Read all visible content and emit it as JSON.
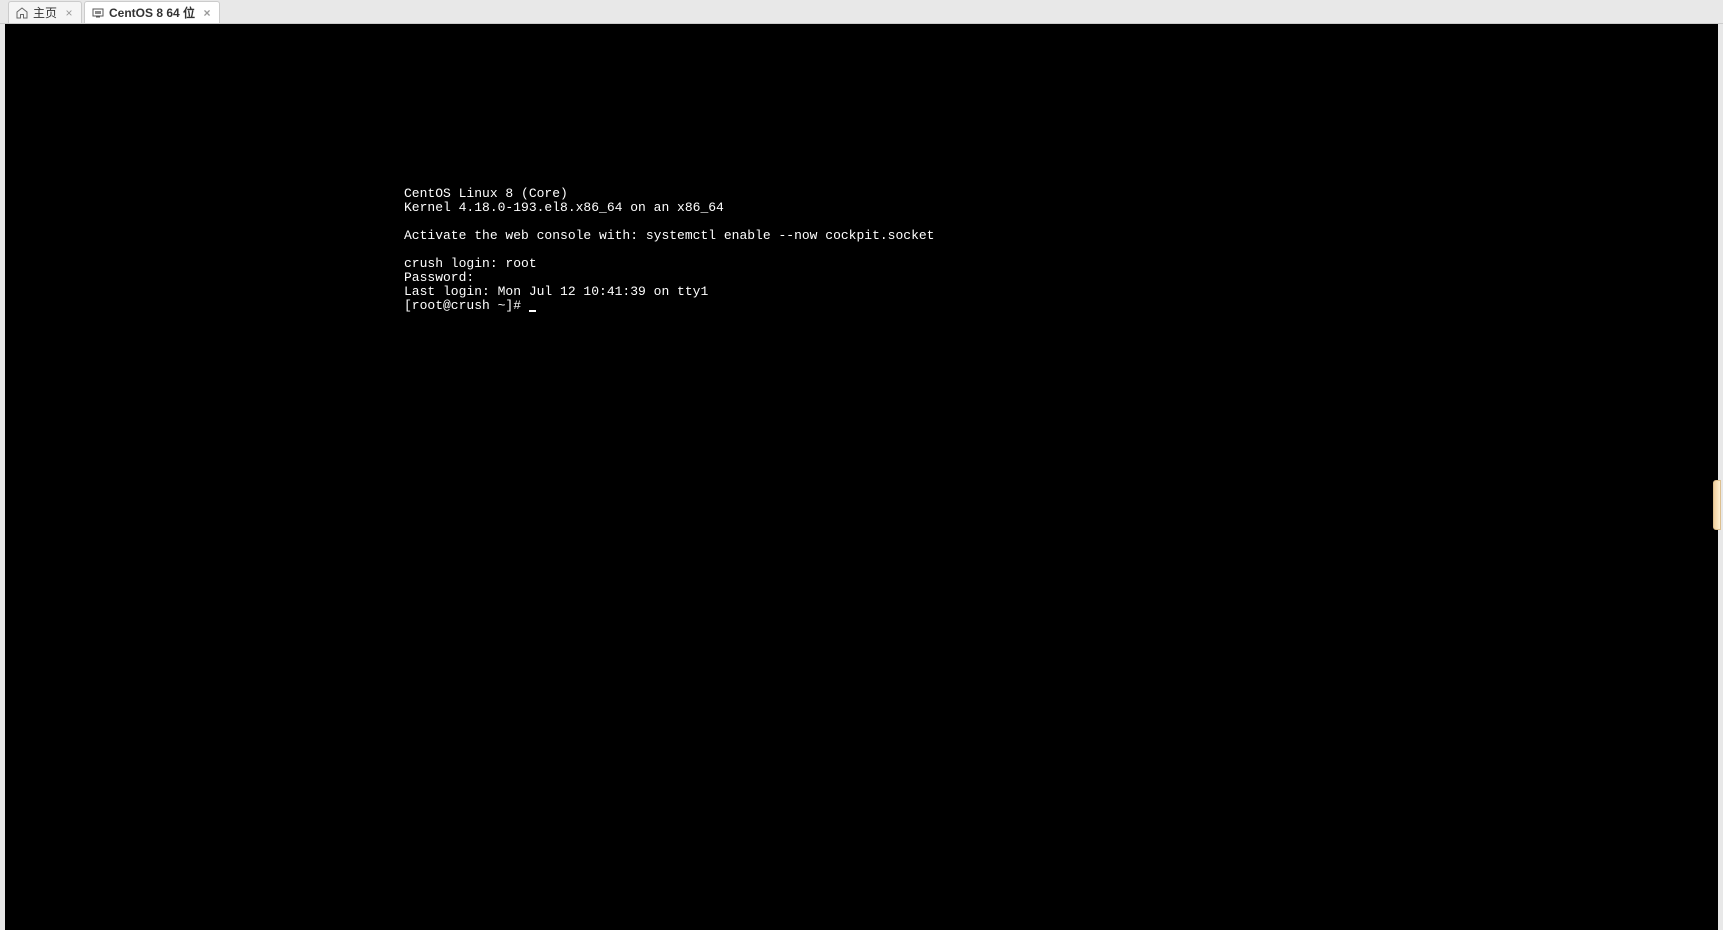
{
  "tabs": [
    {
      "label": "主页",
      "icon": "home"
    },
    {
      "label": "CentOS 8 64 位",
      "icon": "vm"
    }
  ],
  "terminal": {
    "lines": [
      "CentOS Linux 8 (Core)",
      "Kernel 4.18.0-193.el8.x86_64 on an x86_64",
      "",
      "Activate the web console with: systemctl enable --now cockpit.socket",
      "",
      "crush login: root",
      "Password:",
      "Last login: Mon Jul 12 10:41:39 on tty1"
    ],
    "prompt": "[root@crush ~]# "
  }
}
